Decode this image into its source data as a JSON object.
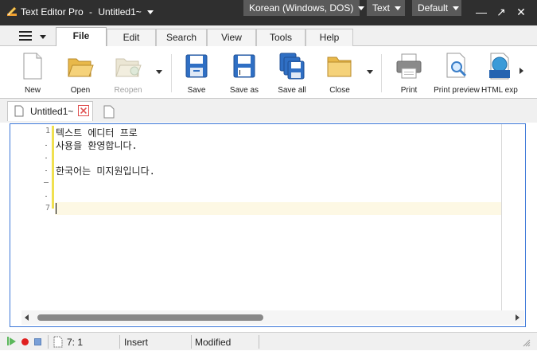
{
  "window": {
    "app_name": "Text Editor Pro",
    "separator": "-",
    "doc_title": "Untitled1~",
    "encoding": "Korean (Windows, DOS)",
    "mode": "Text",
    "theme": "Default",
    "controls": {
      "minimize": "—",
      "maximize": "↗",
      "close": "✕"
    }
  },
  "ribbon_tabs": [
    "File",
    "Edit",
    "Search",
    "View",
    "Tools",
    "Help"
  ],
  "ribbon": {
    "new": "New",
    "open": "Open",
    "reopen": "Reopen",
    "save": "Save",
    "save_as": "Save as",
    "save_all": "Save all",
    "close": "Close",
    "print": "Print",
    "print_preview": "Print preview",
    "html_export": "HTML export"
  },
  "doc_tab": {
    "label": "Untitled1~"
  },
  "editor": {
    "line_numbers": {
      "first": "1",
      "last": "7"
    },
    "lines": [
      "텍스트 에디터 프로",
      "사용을 환영합니다.",
      "",
      "한국어는 미지원입니다.",
      "",
      "",
      ""
    ],
    "scroll_fraction": 0.48
  },
  "status": {
    "position": "7: 1",
    "insert_mode": "Insert",
    "modified": "Modified"
  },
  "colors": {
    "titlebar": "#2f2f2f",
    "accent": "#3c78d8",
    "change_bar": "#f0e050",
    "current_line": "#fdf8e4"
  }
}
